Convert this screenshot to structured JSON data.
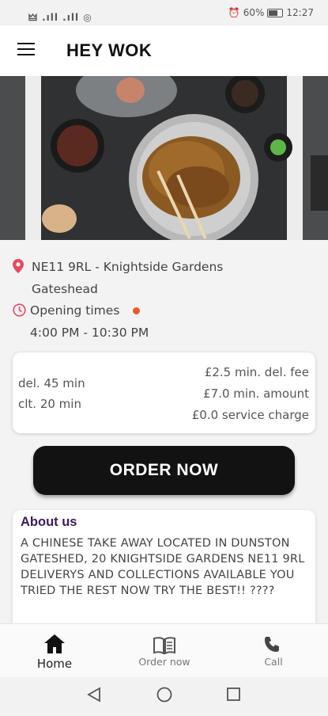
{
  "status": {
    "left": "🜲 .ıll .ıll ◎",
    "battery": "60%",
    "time": "12:27"
  },
  "header": {
    "title": "HEY WOK"
  },
  "restaurant": {
    "address_line1": "NE11 9RL - Knightside Gardens",
    "address_line2": "Gateshead",
    "opening_label": "Opening times",
    "hours": "4:00 PM - 10:30 PM",
    "status_color": "#e8592e"
  },
  "delivery": {
    "delivery_time": "del. 45 min",
    "collection_time": "clt. 20 min",
    "min_fee": "£2.5 min. del. fee",
    "min_amount": "£7.0 min. amount",
    "service_charge": "£0.0 service charge"
  },
  "order_button": "ORDER NOW",
  "about": {
    "heading": "About us",
    "text": "A CHINESE TAKE AWAY LOCATED IN DUNSTON GATESHED, 20 KNIGHTSIDE GARDENS NE11 9RL DELIVERYS AND COLLECTIONS AVAILABLE YOU TRIED THE REST NOW TRY THE BEST!! ????"
  },
  "nav": [
    {
      "label": "Home",
      "icon": "home-icon"
    },
    {
      "label": "Order now",
      "icon": "menu-book-icon"
    },
    {
      "label": "Call",
      "icon": "phone-icon"
    }
  ],
  "colors": {
    "accent_dark": "#121212",
    "about_heading": "#3b1a66",
    "pin": "#e8495e"
  }
}
